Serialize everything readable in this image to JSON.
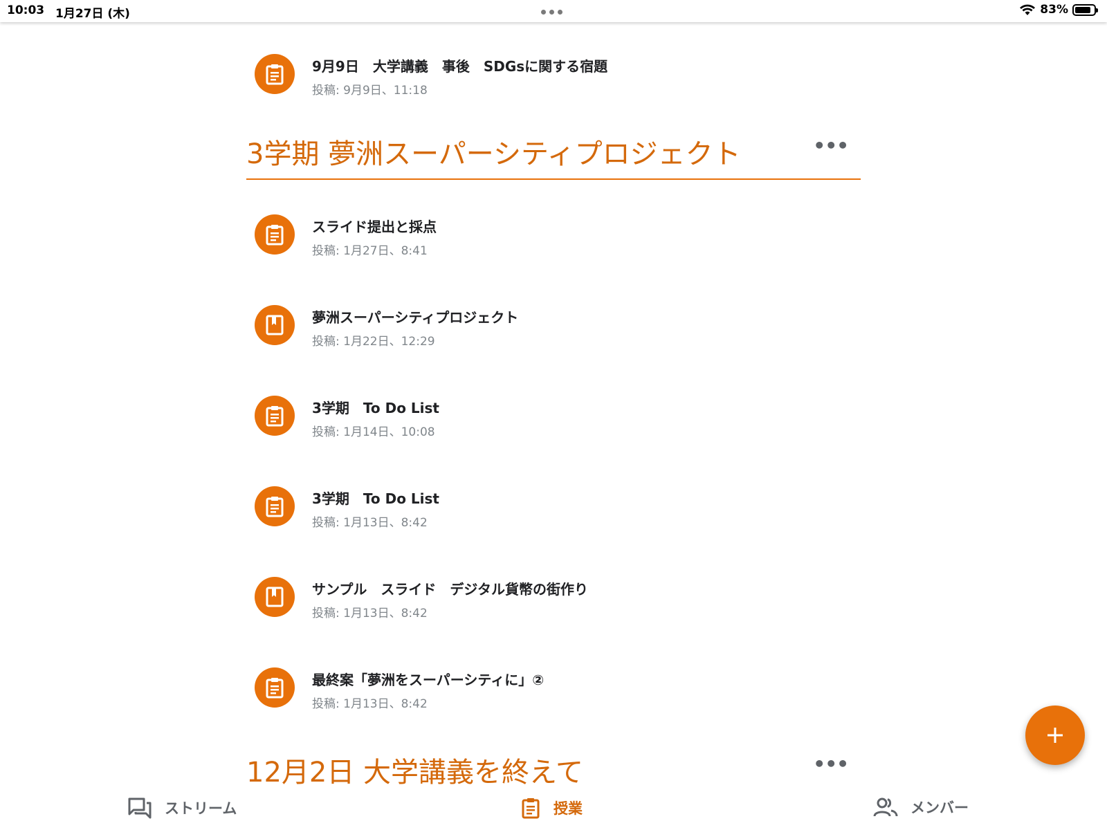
{
  "status_bar": {
    "time": "10:03",
    "date": "1月27日 (木)",
    "battery_percent": "83%",
    "battery_level": 0.83
  },
  "colors": {
    "accent": "#e8710a",
    "accent_text": "#d4690b",
    "meta_text": "#80868b"
  },
  "top_item": {
    "icon": "assignment-icon",
    "title": "9月9日　大学講義　事後　SDGsに関する宿題",
    "meta": "投稿: 9月9日、11:18"
  },
  "topics": [
    {
      "title": "3学期 夢洲スーパーシティプロジェクト",
      "more": "•••",
      "items": [
        {
          "icon": "assignment-icon",
          "title": "スライド提出と採点",
          "meta": "投稿: 1月27日、8:41"
        },
        {
          "icon": "material-icon",
          "title": "夢洲スーパーシティプロジェクト",
          "meta": "投稿: 1月22日、12:29"
        },
        {
          "icon": "assignment-icon",
          "title": "3学期　To Do List",
          "meta": "投稿: 1月14日、10:08"
        },
        {
          "icon": "assignment-icon",
          "title": "3学期　To Do List",
          "meta": "投稿: 1月13日、8:42"
        },
        {
          "icon": "material-icon",
          "title": "サンプル　スライド　デジタル貨幣の街作り",
          "meta": "投稿: 1月13日、8:42"
        },
        {
          "icon": "assignment-icon",
          "title": "最終案「夢洲をスーパーシティに」②",
          "meta": "投稿: 1月13日、8:42"
        }
      ]
    },
    {
      "title": "12月2日 大学講義を終えて",
      "more": "•••"
    }
  ],
  "fab": {
    "label": "+"
  },
  "bottom_nav": [
    {
      "label": "ストリーム",
      "icon": "stream-icon",
      "active": false
    },
    {
      "label": "授業",
      "icon": "classwork-icon",
      "active": true
    },
    {
      "label": "メンバー",
      "icon": "people-icon",
      "active": false
    }
  ]
}
